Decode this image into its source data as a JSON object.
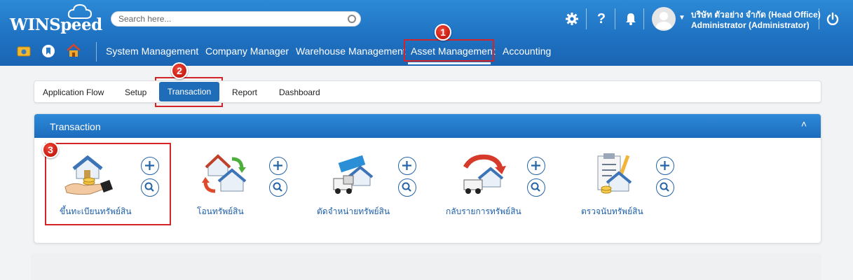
{
  "brand": {
    "name": "WINSpeed"
  },
  "search": {
    "placeholder": "Search here..."
  },
  "header_icons": [
    "gear-icon",
    "help-icon",
    "bell-icon",
    "power-icon"
  ],
  "help_glyph": "?",
  "user": {
    "company": "บริษัท ตัวอย่าง จำกัด (Head Office)",
    "role": "Administrator (Administrator)"
  },
  "modules": [
    {
      "label": "System Management"
    },
    {
      "label": "Company Manager"
    },
    {
      "label": "Warehouse Management"
    },
    {
      "label": "Asset Management",
      "active": true
    },
    {
      "label": "Accounting"
    }
  ],
  "tabs": [
    {
      "label": "Application Flow"
    },
    {
      "label": "Setup"
    },
    {
      "label": "Transaction",
      "active": true
    },
    {
      "label": "Report"
    },
    {
      "label": "Dashboard"
    }
  ],
  "panel": {
    "title": "Transaction",
    "collapse_glyph": "˄"
  },
  "items": [
    {
      "label": "ขึ้นทะเบียนทรัพย์สิน"
    },
    {
      "label": "โอนทรัพย์สิน"
    },
    {
      "label": "ตัดจำหน่ายทรัพย์สิน"
    },
    {
      "label": "กลับรายการทรัพย์สิน"
    },
    {
      "label": "ตรวจนับทรัพย์สิน"
    }
  ],
  "steps": [
    "1",
    "2",
    "3"
  ],
  "colors": {
    "header": "#1f72c2",
    "accent": "#1f6db8",
    "highlight": "#d3242a",
    "badge": "#c81d12"
  }
}
